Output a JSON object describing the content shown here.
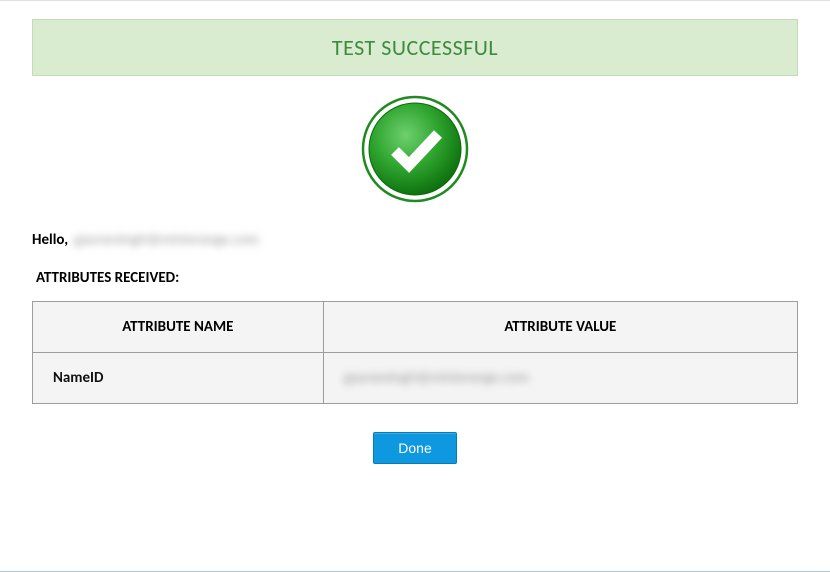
{
  "banner": {
    "title": "TEST SUCCESSFUL"
  },
  "greeting": {
    "prefix": "Hello,",
    "value": "gauravsingh@miniorange.com"
  },
  "attributesHeading": "ATTRIBUTES RECEIVED:",
  "table": {
    "headers": {
      "name": "ATTRIBUTE NAME",
      "value": "ATTRIBUTE VALUE"
    },
    "rows": [
      {
        "name": "NameID",
        "value": "gauravsingh@miniorange.com"
      }
    ]
  },
  "doneButton": "Done",
  "colors": {
    "successGreen": "#3d8b3d",
    "bannerBg": "#d9ecd0",
    "buttonBg": "#0e98e0"
  }
}
